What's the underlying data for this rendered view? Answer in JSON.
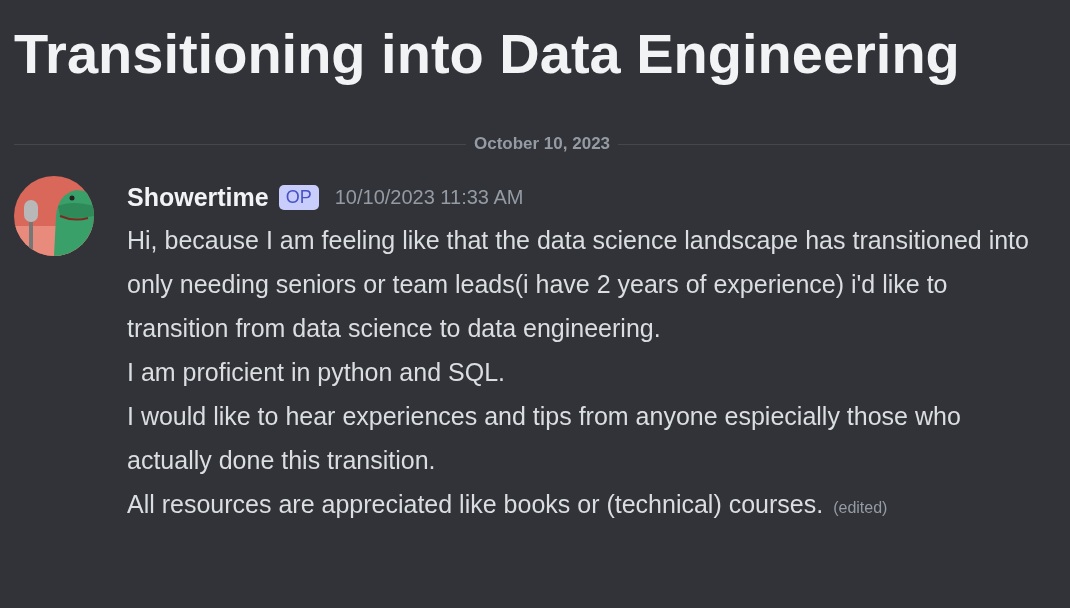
{
  "title": "Transitioning into Data Engineering",
  "date_divider": "October 10, 2023",
  "message": {
    "author": "Showertime",
    "badge": "OP",
    "timestamp": "10/10/2023 11:33 AM",
    "paragraphs": [
      "Hi, because I am feeling like that the data science landscape has transitioned into only needing seniors or team leads(i have 2 years of experience)  i'd like to transition from data science to data engineering.",
      "I am proficient in python and SQL.",
      "I would like to hear experiences and tips from anyone espiecially those who actually done this transition.",
      "All resources are appreciated like books or (technical) courses."
    ],
    "edited_label": "(edited)"
  }
}
